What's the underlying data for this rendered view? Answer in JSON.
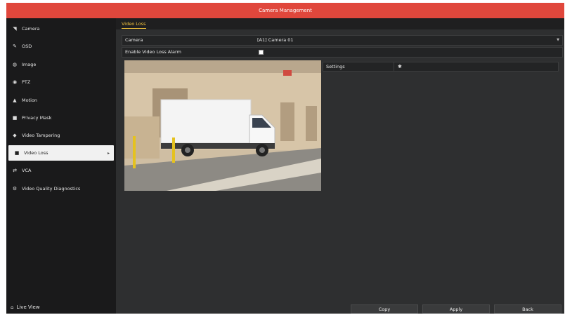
{
  "window": {
    "title": "Camera Management"
  },
  "sidebar": {
    "items": [
      {
        "label": "Camera",
        "icon": "camera-icon"
      },
      {
        "label": "OSD",
        "icon": "osd-icon"
      },
      {
        "label": "Image",
        "icon": "image-icon"
      },
      {
        "label": "PTZ",
        "icon": "ptz-icon"
      },
      {
        "label": "Motion",
        "icon": "motion-icon"
      },
      {
        "label": "Privacy Mask",
        "icon": "privacy-mask-icon"
      },
      {
        "label": "Video Tampering",
        "icon": "video-tampering-icon"
      },
      {
        "label": "Video Loss",
        "icon": "video-loss-icon",
        "active": true
      },
      {
        "label": "VCA",
        "icon": "vca-icon"
      },
      {
        "label": "Video Quality Diagnostics",
        "icon": "diagnostics-icon"
      }
    ],
    "live_view": "Live View"
  },
  "main": {
    "tab": "Video Loss",
    "camera_label": "Camera",
    "camera_value": "[A1] Camera 01",
    "alarm_label": "Enable Video Loss Alarm",
    "alarm_checked": true,
    "settings_label": "Settings"
  },
  "buttons": {
    "copy": "Copy",
    "apply": "Apply",
    "back": "Back"
  },
  "colors": {
    "title_bar": "#e0473c",
    "tab_accent": "#f4c43c",
    "background": "#2e2f30"
  }
}
